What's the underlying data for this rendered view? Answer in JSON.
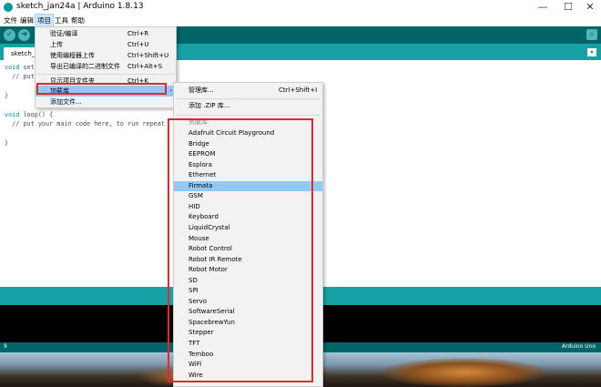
{
  "window": {
    "title": "sketch_jan24a | Arduino 1.8.13",
    "minimize": "—",
    "maximize": "☐",
    "close": "✕"
  },
  "menubar": {
    "items": [
      "文件",
      "编辑",
      "项目",
      "工具",
      "帮助"
    ]
  },
  "toolbar": {
    "verify_icon": "✓",
    "upload_icon": "➜",
    "serial_icon": "⌕"
  },
  "tab": {
    "name": "sketch_j",
    "arrow": "▾"
  },
  "code": {
    "line1_kw": "void",
    "line1": " set",
    "line2": "  // put",
    "line3": "}",
    "line4_kw": "void",
    "line4": " loop() {",
    "line5": "  // put your main code here, to run repeat",
    "line6": "}"
  },
  "footer": {
    "line_number": "9",
    "board": "Arduino Uno"
  },
  "project_menu": {
    "items": [
      {
        "label": "验证/编译",
        "shortcut": "Ctrl+R"
      },
      {
        "label": "上传",
        "shortcut": "Ctrl+U"
      },
      {
        "label": "使用编程器上传",
        "shortcut": "Ctrl+Shift+U"
      },
      {
        "label": "导出已编译的二进制文件",
        "shortcut": "Ctrl+Alt+S"
      },
      {
        "label": "显示项目文件夹",
        "shortcut": "Ctrl+K"
      },
      {
        "label": "加载库",
        "shortcut": ""
      },
      {
        "label": "添加文件...",
        "shortcut": ""
      }
    ],
    "submenu_arrow": "›"
  },
  "library_menu": {
    "manage": {
      "label": "管理库...",
      "shortcut": "Ctrl+Shift+I"
    },
    "add_zip": {
      "label": "添加 .ZIP 库..."
    },
    "section_header": "贡献库",
    "libraries": [
      "Adafruit Circuit Playground",
      "Bridge",
      "EEPROM",
      "Esplora",
      "Ethernet",
      "Firmata",
      "GSM",
      "HID",
      "Keyboard",
      "LiquidCrystal",
      "Mouse",
      "Robot Control",
      "Robot IR Remote",
      "Robot Motor",
      "SD",
      "SPI",
      "Servo",
      "SoftwareSerial",
      "SpacebrewYun",
      "Stepper",
      "TFT",
      "Temboo",
      "WiFi",
      "Wire"
    ],
    "highlighted": "Firmata"
  },
  "colors": {
    "teal_dark": "#006468",
    "teal": "#17a1a5",
    "highlight": "#91c9f7",
    "annotation_red": "#e0282e"
  }
}
